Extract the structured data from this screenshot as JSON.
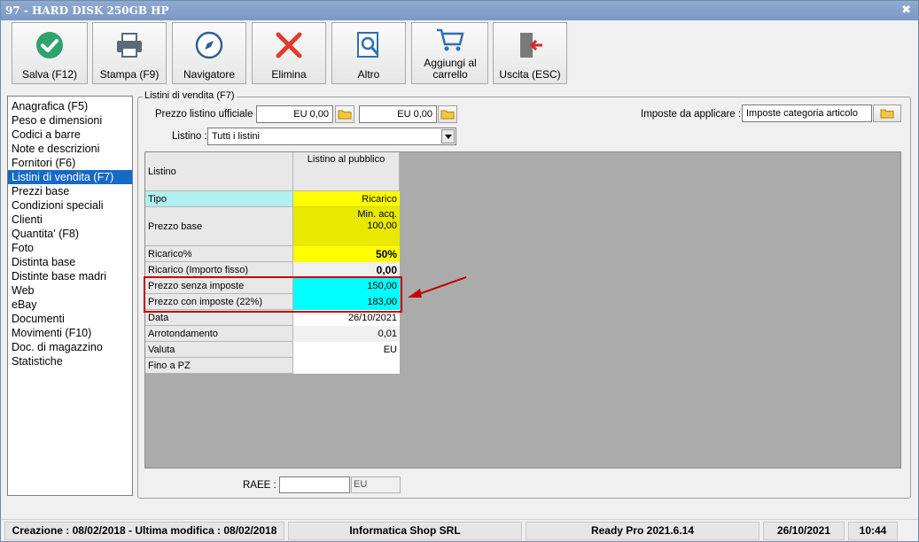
{
  "window": {
    "title": "97 - HARD DISK 250GB HP",
    "close_glyph": "✖"
  },
  "toolbar": {
    "buttons": [
      {
        "label": "Salva (F12)",
        "icon": "check-icon",
        "color": "#2ea36e"
      },
      {
        "label": "Stampa (F9)",
        "icon": "printer-icon",
        "color": "#5a6a7a"
      },
      {
        "label": "Navigatore",
        "icon": "compass-icon",
        "color": "#2f5f9a"
      },
      {
        "label": "Elimina",
        "icon": "delete-x-icon",
        "color": "#e23b2a"
      },
      {
        "label": "Altro",
        "icon": "search-doc-icon",
        "color": "#2f6fb2"
      },
      {
        "label": "Aggiungi al carrello",
        "icon": "cart-icon",
        "color": "#2f6fb2"
      },
      {
        "label": "Uscita (ESC)",
        "icon": "exit-door-icon",
        "color": "#d62a2a"
      }
    ]
  },
  "sidebar": {
    "items": [
      "Anagrafica (F5)",
      "Peso e dimensioni",
      "Codici a barre",
      "Note e descrizioni",
      "Fornitori (F6)",
      "Listini di vendita (F7)",
      "Prezzi base",
      "Condizioni speciali",
      "Clienti",
      "Quantita' (F8)",
      "Foto",
      "Distinta base",
      "Distinte base madri",
      "Web",
      "eBay",
      "Documenti",
      "Movimenti (F10)",
      "Doc. di magazzino",
      "Statistiche"
    ],
    "selected_index": 5
  },
  "listini": {
    "group_title": "Listini di vendita (F7)",
    "prezzo_ufficiale_label": "Prezzo listino ufficiale :",
    "prezzo_ufficiale_1": "EU 0,00",
    "prezzo_ufficiale_2": "EU 0,00",
    "imposte_label": "Imposte da applicare :",
    "imposte_value": "Imposte categoria articolo",
    "listino_label": "Listino :",
    "listino_value": "Tutti i listini"
  },
  "grid": {
    "header_left": "Listino",
    "header_col": "Listino al pubblico",
    "rows": [
      {
        "label": "Tipo",
        "value": "Ricarico"
      },
      {
        "label": "Prezzo base",
        "value": "Min. acq.",
        "value2": "100,00"
      },
      {
        "label": "Ricarico%",
        "value": "50%"
      },
      {
        "label": "Ricarico (Importo fisso)",
        "value": "0,00"
      },
      {
        "label": "Prezzo senza imposte",
        "value": "150,00"
      },
      {
        "label": "Prezzo con imposte (22%)",
        "value": "183,00"
      },
      {
        "label": "Data",
        "value": "26/10/2021"
      },
      {
        "label": "Arrotondamento",
        "value": "0,01"
      },
      {
        "label": "Valuta",
        "value": "EU"
      },
      {
        "label": "Fino a PZ",
        "value": ""
      }
    ],
    "colors": {
      "yellow": "#ffff00",
      "cyan": "#00ffff",
      "lightcyan": "#b0f0f0",
      "gray": "#ababab"
    }
  },
  "raee": {
    "label": "RAEE :",
    "value": "",
    "currency": "EU"
  },
  "status": {
    "creazione": "Creazione : 08/02/2018 - Ultima modifica : 08/02/2018",
    "company": "Informatica Shop SRL",
    "version": "Ready Pro 2021.6.14",
    "date": "26/10/2021",
    "time": "10:44"
  }
}
